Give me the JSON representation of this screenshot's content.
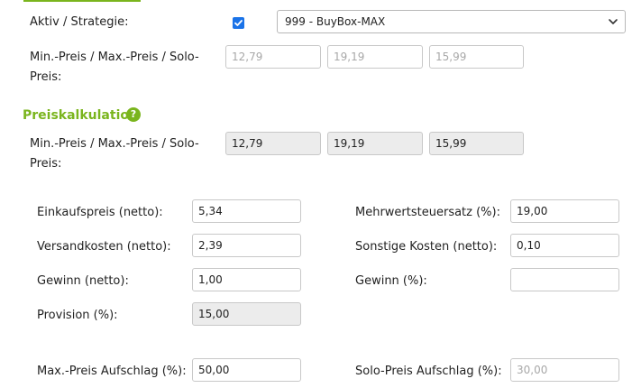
{
  "top_section": {
    "strategy_label": "Aktiv / Strategie:",
    "strategy_checked": true,
    "strategy_select_value": "999 - BuyBox-MAX",
    "price_label_line1": "Min.-Preis / Max.-Preis / Solo-",
    "price_label_line2": "Preis:",
    "min_price_placeholder": "12,79",
    "max_price_placeholder": "19,19",
    "solo_price_placeholder": "15,99"
  },
  "calc_section": {
    "title": "Preiskalkulation",
    "help_icon": "question-circle-icon",
    "price_label_line1": "Min.-Preis / Max.-Preis / Solo-",
    "price_label_line2": "Preis:",
    "min_price": "12,79",
    "max_price": "19,19",
    "solo_price": "15,99"
  },
  "fields": {
    "einkaufspreis_label": "Einkaufspreis (netto):",
    "einkaufspreis_value": "5,34",
    "mwst_label": "Mehrwertsteuersatz (%):",
    "mwst_value": "19,00",
    "versandkosten_label": "Versandkosten (netto):",
    "versandkosten_value": "2,39",
    "sonstige_label": "Sonstige Kosten (netto):",
    "sonstige_value": "0,10",
    "gewinn_netto_label": "Gewinn (netto):",
    "gewinn_netto_value": "1,00",
    "gewinn_pct_label": "Gewinn (%):",
    "gewinn_pct_value": "",
    "provision_label": "Provision (%):",
    "provision_value": "15,00",
    "max_aufschlag_label": "Max.-Preis Aufschlag (%):",
    "max_aufschlag_value": "50,00",
    "solo_aufschlag_label": "Solo-Preis Aufschlag (%):",
    "solo_aufschlag_value": "30,00"
  },
  "colors": {
    "accent_green": "#7ab51d",
    "checkbox_blue": "#1a73e8",
    "readonly_bg": "#ececec"
  }
}
